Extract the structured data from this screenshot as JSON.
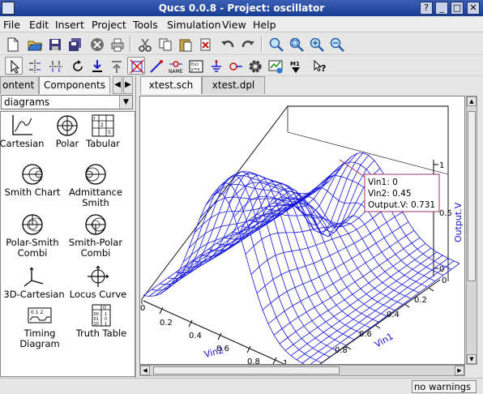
{
  "window": {
    "title": "Qucs 0.0.8 - Project: oscillator",
    "buttons": [
      "?",
      "_",
      "□",
      "✕"
    ]
  },
  "menu": [
    "File",
    "Edit",
    "Insert",
    "Project",
    "Tools",
    "Simulation",
    "View",
    "Help"
  ],
  "left_tabs": [
    "ontent",
    "Components"
  ],
  "category": "diagrams",
  "components": [
    {
      "label": "Cartesian",
      "icon": "cartesian-icon"
    },
    {
      "label": "Polar",
      "icon": "polar-icon"
    },
    {
      "label": "Tabular",
      "icon": "tabular-icon"
    },
    {
      "label": "Smith Chart",
      "icon": "smith-chart-icon"
    },
    {
      "label": "Admittance Smith",
      "icon": "admittance-smith-icon"
    },
    {
      "label": "Polar-Smith Combi",
      "icon": "polar-smith-icon"
    },
    {
      "label": "Smith-Polar Combi",
      "icon": "smith-polar-icon"
    },
    {
      "label": "3D-Cartesian",
      "icon": "cartesian-3d-icon"
    },
    {
      "label": "Locus Curve",
      "icon": "locus-curve-icon"
    },
    {
      "label": "Timing Diagram",
      "icon": "timing-diagram-icon"
    },
    {
      "label": "Truth Table",
      "icon": "truth-table-icon"
    }
  ],
  "doc_tabs": [
    "xtest.sch",
    "xtest.dpl"
  ],
  "plot": {
    "y_axis_label": "Output.V",
    "x_axis_label": "Vin1",
    "z_axis_label": "Vin2",
    "y_ticks": [
      "1",
      "0.5",
      "0"
    ],
    "vin1_ticks": [
      "0",
      "0.2",
      "0.4",
      "0.6",
      "0.8"
    ],
    "vin2_ticks": [
      "0",
      "0.2",
      "0.4",
      "0.6",
      "0.8",
      "1"
    ],
    "marker": {
      "line1": "Vin1: 0",
      "line2": "Vin2: 0.45",
      "line3": "Output.V: 0.731"
    },
    "colors": {
      "mesh": "#1414dc",
      "marker": "#a0306a"
    }
  },
  "chart_data": {
    "type": "surface",
    "xlabel": "Vin1",
    "ylabel": "Vin2",
    "zlabel": "Output.V",
    "xlim": [
      0,
      1
    ],
    "ylim": [
      0,
      1
    ],
    "zlim": [
      0,
      1
    ],
    "marker_point": {
      "Vin1": 0,
      "Vin2": 0.45,
      "Output.V": 0.731
    }
  },
  "status": {
    "text": "no warnings"
  }
}
